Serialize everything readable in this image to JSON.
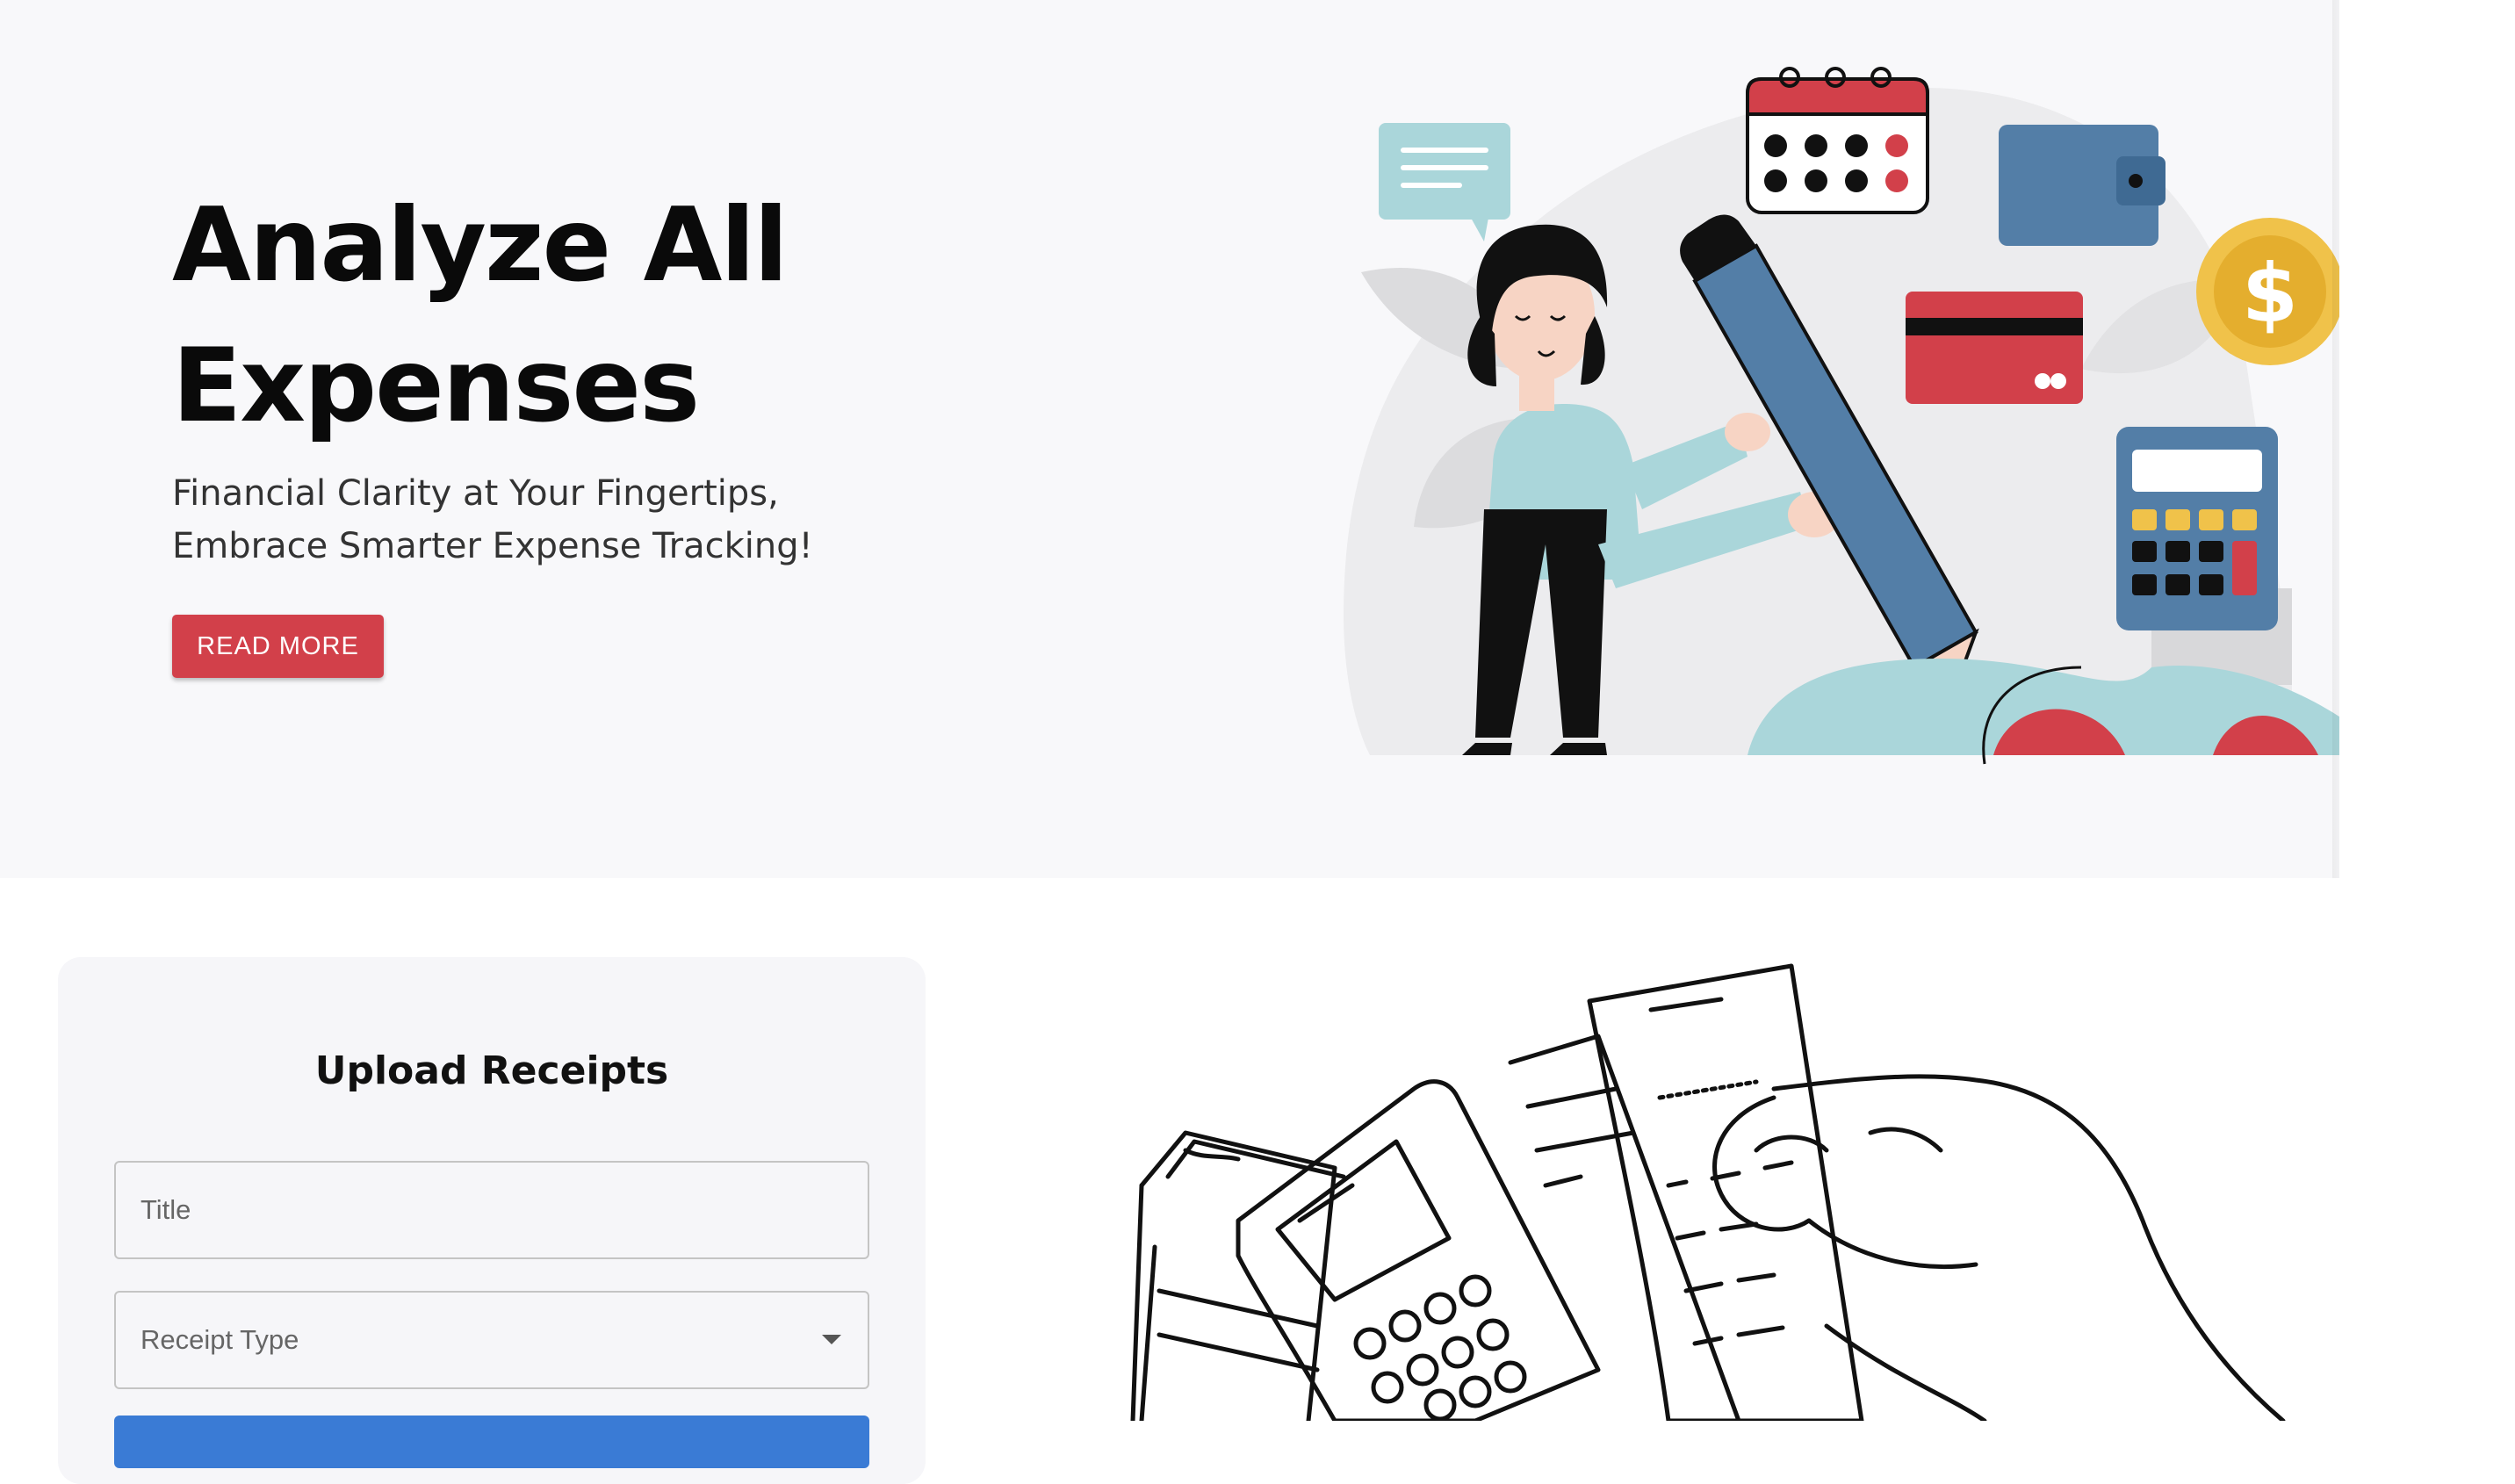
{
  "hero": {
    "title_line1": "Analyze All",
    "title_line2": "Expenses",
    "subtitle_line1": "Financial Clarity at Your Fingertips,",
    "subtitle_line2": "Embrace Smarter Expense Tracking!",
    "button_label": "READ MORE",
    "accent_color": "#d2404a"
  },
  "upload": {
    "title": "Upload Receipts",
    "title_placeholder": "Title",
    "receipt_type_label": "Receipt Type"
  },
  "icons": [
    "chat-bubble-icon",
    "calendar-icon",
    "wallet-icon",
    "credit-card-icon",
    "dollar-coin-icon",
    "calculator-icon",
    "dropdown-caret-icon"
  ]
}
